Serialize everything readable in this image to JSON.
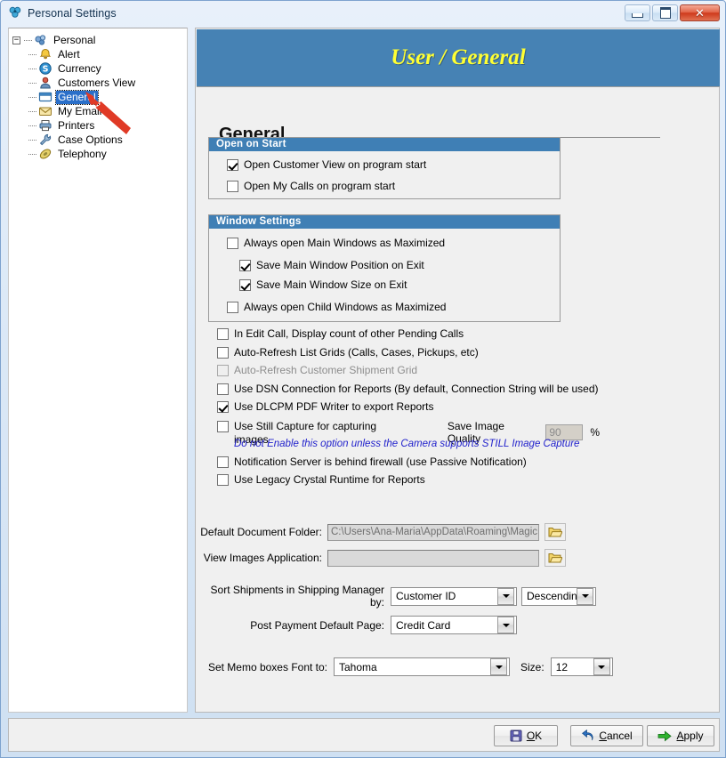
{
  "window": {
    "title": "Personal Settings",
    "icon": "app-settings-icon",
    "minimize_label": "Minimize",
    "maximize_label": "Maximize",
    "close_label": "Close"
  },
  "tree": {
    "root": {
      "label": "Personal",
      "icon": "personal-group-icon",
      "expander": "minus"
    },
    "items": [
      {
        "label": "Alert",
        "icon": "alert-icon"
      },
      {
        "label": "Currency",
        "icon": "currency-icon"
      },
      {
        "label": "Customers View",
        "icon": "customers-view-icon"
      },
      {
        "label": "General",
        "icon": "general-window-icon",
        "selected": true
      },
      {
        "label": "My Email",
        "icon": "my-email-icon"
      },
      {
        "label": "Printers",
        "icon": "printers-icon"
      },
      {
        "label": "Case Options",
        "icon": "case-options-icon"
      },
      {
        "label": "Telephony",
        "icon": "telephony-icon"
      }
    ]
  },
  "banner": {
    "title": "User / General"
  },
  "page": {
    "heading": "General"
  },
  "open_on_start": {
    "header": "Open on Start",
    "options": [
      {
        "label": "Open Customer View on program start",
        "checked": true
      },
      {
        "label": "Open My Calls on program start",
        "checked": false
      }
    ]
  },
  "window_settings": {
    "header": "Window Settings",
    "options": [
      {
        "label": "Always open Main Windows as Maximized",
        "checked": false,
        "indent": 0
      },
      {
        "label": "Save Main Window Position on Exit",
        "checked": true,
        "indent": 1
      },
      {
        "label": "Save Main Window Size on Exit",
        "checked": true,
        "indent": 1
      },
      {
        "label": "Always open Child Windows as Maximized",
        "checked": false,
        "indent": 0
      }
    ]
  },
  "flags": [
    {
      "label": "In Edit Call, Display count of other Pending Calls",
      "checked": false,
      "disabled": false
    },
    {
      "label": "Auto-Refresh List Grids (Calls, Cases, Pickups, etc)",
      "checked": false,
      "disabled": false
    },
    {
      "label": "Auto-Refresh Customer Shipment Grid",
      "checked": false,
      "disabled": true
    },
    {
      "label": "Use DSN Connection for Reports (By default, Connection String will be used)",
      "checked": false,
      "disabled": false
    },
    {
      "label": "Use DLCPM PDF Writer to export Reports",
      "checked": true,
      "disabled": false
    }
  ],
  "still_capture": {
    "label": "Use Still Capture for capturing images",
    "checked": false,
    "quality_label": "Save Image Quality",
    "quality_value": "90",
    "percent": "%",
    "hint": "Do not Enable this option unless the Camera supports STILL Image Capture"
  },
  "flags2": [
    {
      "label": "Notification Server is behind firewall (use Passive Notification)",
      "checked": false
    },
    {
      "label": "Use Legacy Crystal Runtime for Reports",
      "checked": false
    }
  ],
  "paths": [
    {
      "label": "Default Document Folder:",
      "value": "C:\\Users\\Ana-Maria\\AppData\\Roaming\\Magic Touch Softwar",
      "placeholder": "",
      "browse_icon": "open-folder-icon"
    },
    {
      "label": "View Images Application:",
      "value": "",
      "placeholder": "",
      "browse_icon": "open-folder-icon"
    }
  ],
  "combos": {
    "sort_shipments": {
      "label": "Sort Shipments in Shipping Manager by:",
      "field_value": "Customer ID",
      "direction_value": "Descending"
    },
    "post_payment": {
      "label": "Post Payment Default Page:",
      "value": "Credit Card"
    },
    "memo_font": {
      "label": "Set Memo boxes Font to:",
      "value": "Tahoma",
      "size_label": "Size:",
      "size_value": "12"
    }
  },
  "buttons": {
    "ok": {
      "pre": "",
      "mnemonic": "O",
      "post": "K",
      "icon": "save-floppy-icon"
    },
    "cancel": {
      "pre": "",
      "mnemonic": "C",
      "post": "ancel",
      "icon": "undo-arrow-icon"
    },
    "apply": {
      "pre": "",
      "mnemonic": "A",
      "post": "pply",
      "icon": "green-arrow-icon"
    }
  },
  "colors": {
    "banner_blue": "#4682b4",
    "group_header_blue": "#3f7fb5",
    "banner_text_yellow": "#ffff33",
    "hint_blue": "#2222cc",
    "selection_blue": "#2a6fc9",
    "annotation_red": "#e03a26"
  }
}
